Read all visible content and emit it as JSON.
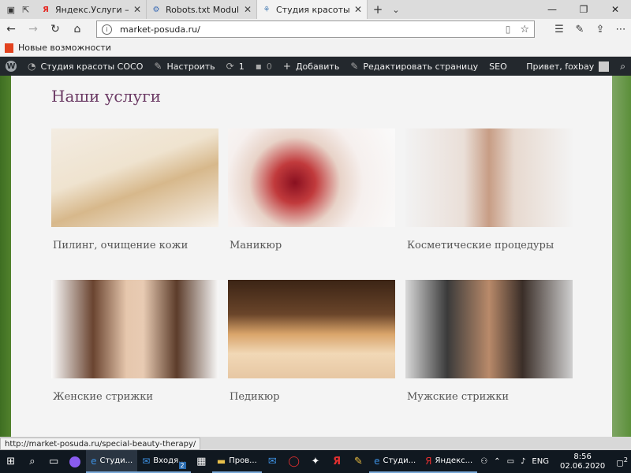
{
  "browser": {
    "tabs": [
      {
        "title": "Яндекс.Услуги — поиск усл",
        "icon": "yandex-icon",
        "active": false
      },
      {
        "title": "Robots.txt Module | Semper",
        "icon": "gear-icon",
        "active": false
      },
      {
        "title": "Студия красоты COCO",
        "icon": "site-icon",
        "active": true
      }
    ],
    "url": "market-posuda.ru/",
    "favorites": {
      "item": "Новые возможности"
    }
  },
  "wp_admin_bar": {
    "site": "Студия красоты COCO",
    "customize": "Настроить",
    "updates": "1",
    "comments": "0",
    "add_new": "Добавить",
    "edit_page": "Редактировать страницу",
    "seo": "SEO",
    "greeting": "Привет, foxbay"
  },
  "page": {
    "heading": "Наши услуги",
    "services": [
      {
        "title": "Пилинг, очищение кожи",
        "image": "peeling-photo"
      },
      {
        "title": "Маникюр",
        "image": "manicure-photo"
      },
      {
        "title": "Косметические процедуры",
        "image": "cosmetic-photo"
      },
      {
        "title": "Женские стрижки",
        "image": "womens-haircut-photo"
      },
      {
        "title": "Педикюр",
        "image": "pedicure-photo"
      },
      {
        "title": "Мужские стрижки",
        "image": "mens-haircut-photo"
      }
    ]
  },
  "status_url": "http://market-posuda.ru/special-beauty-therapy/",
  "taskbar": {
    "apps": [
      {
        "label": "Студи...",
        "icon": "edge-icon"
      },
      {
        "label": "Входя...",
        "icon": "mail-icon"
      },
      {
        "label": "Пров...",
        "icon": "folder-icon"
      },
      {
        "label": "Студи...",
        "icon": "edge-icon"
      },
      {
        "label": "Яндекс...",
        "icon": "yandex-browser-icon"
      }
    ],
    "badge": "2",
    "lang": "ENG",
    "time": "8:56",
    "date": "02.06.2020",
    "notifications": "2"
  }
}
